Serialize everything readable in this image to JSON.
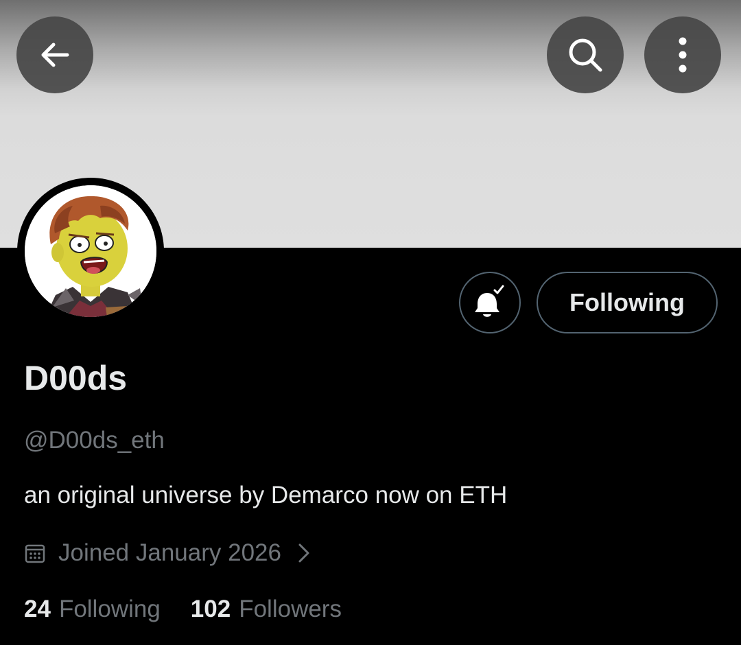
{
  "header": {
    "back_icon": "arrow-left-icon",
    "search_icon": "search-icon",
    "more_icon": "more-vertical-icon"
  },
  "profile": {
    "display_name": "D00ds",
    "handle": "@D00ds_eth",
    "bio": "an original universe by Demarco now on ETH",
    "joined": "Joined January 2026",
    "avatar_icon": "cartoon-avatar"
  },
  "actions": {
    "notifications_icon": "bell-check-icon",
    "follow_label": "Following"
  },
  "stats": {
    "following_count": "24",
    "following_label": "Following",
    "followers_count": "102",
    "followers_label": "Followers"
  },
  "colors": {
    "background": "#000000",
    "primary_text": "#e7e9ea",
    "secondary_text": "#71767b",
    "border": "#536471"
  }
}
